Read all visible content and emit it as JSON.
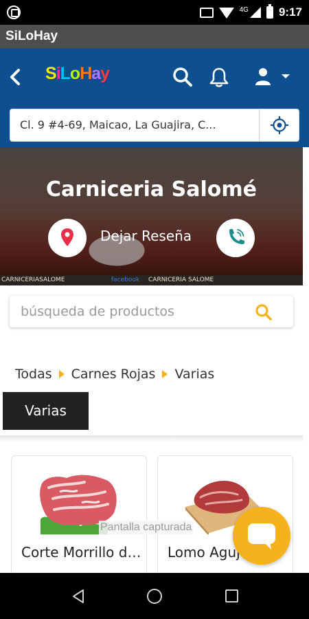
{
  "status_bar": {
    "network": "4G",
    "time": "9:17"
  },
  "app_title": "SiLoHay",
  "header": {
    "logo_letters": [
      "S",
      "i",
      "L",
      "o",
      "H",
      "a",
      "y"
    ],
    "logo_colors": [
      "#e8f000",
      "#ff2d9b",
      "#00c2ff",
      "#b0ff00",
      "#ff7a00",
      "#a47bff",
      "#ff3d3d"
    ],
    "address": "Cl. 9 #4-69, Maicao, La Guajira, C..."
  },
  "store": {
    "name": "Carniceria Salomé",
    "review_label": "Dejar Reseña",
    "banner_caption_left": "CARNICERIASALOME",
    "banner_caption_fb": "facebook",
    "banner_caption_right": "CARNICERIA SALOME"
  },
  "product_search": {
    "placeholder": "búsqueda de productos"
  },
  "breadcrumb": [
    "Todas",
    "Carnes Rojas",
    "Varias"
  ],
  "category_tag": "Varias",
  "products": [
    {
      "name": "Corte Morrillo de Res"
    },
    {
      "name": "Lomo Aguja"
    }
  ],
  "toast": "Pantalla capturada",
  "colors": {
    "header_bg": "#0e4f8f",
    "accent": "#f5b21c",
    "pin": "#e5304a",
    "phone": "#1c8c8c"
  }
}
